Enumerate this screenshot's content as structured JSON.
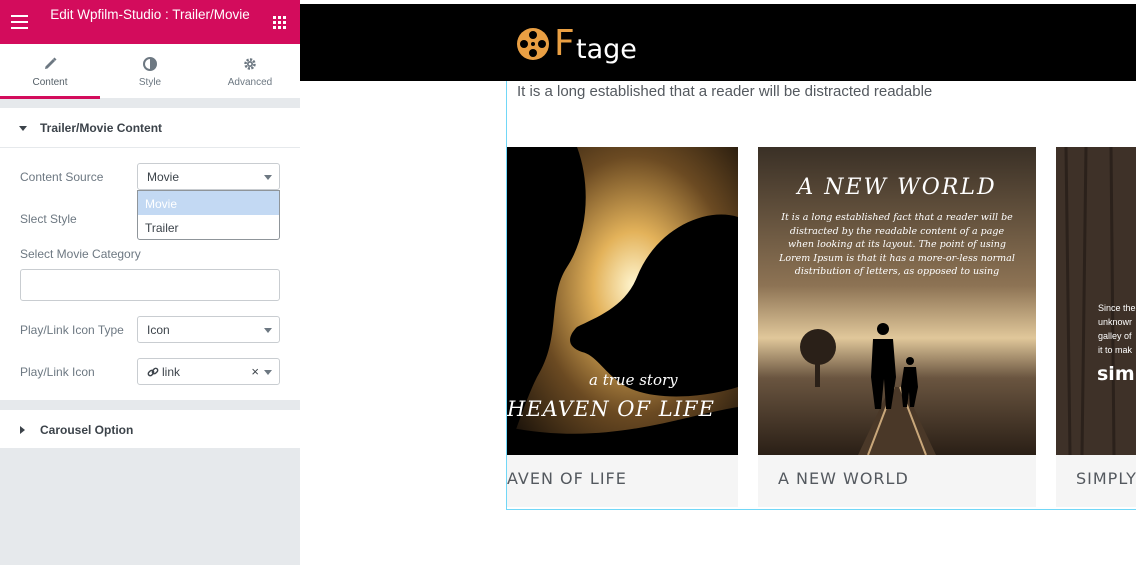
{
  "panel": {
    "header_title": "Edit Wpfilm-Studio : Trailer/Movie",
    "tabs": [
      {
        "label": "Content",
        "icon": "pencil-icon"
      },
      {
        "label": "Style",
        "icon": "contrast-icon"
      },
      {
        "label": "Advanced",
        "icon": "gear-icon"
      }
    ],
    "accent_color": "#d30c5c",
    "section1": {
      "title": "Trailer/Movie Content",
      "content_source_label": "Content Source",
      "content_source_value": "Movie",
      "dropdown_options": [
        "Movie",
        "Trailer"
      ],
      "slect_style_label": "Slect Style",
      "movie_category_label": "Select Movie Category",
      "icon_type_label": "Play/Link Icon Type",
      "icon_type_value": "Icon",
      "icon_label": "Play/Link Icon",
      "icon_value": "link",
      "clear_symbol": "×"
    },
    "section2": {
      "title": "Carousel Option"
    }
  },
  "preview": {
    "logo_text": "tage",
    "logo_f": "F",
    "intro_text": "It is a long established that a reader will be distracted readable",
    "cards": [
      {
        "title": "AVEN OF LIFE",
        "poster_tagline": "a true story",
        "poster_title": "HEAVEN OF LIFE"
      },
      {
        "title": "A NEW WORLD",
        "poster_title": "A NEW WORLD",
        "poster_body": "It is a long established fact that a reader will be distracted by the readable content of a page when looking at its layout. The point of using Lorem Ipsum is that it has a more-or-less normal distribution of letters, as opposed to using"
      },
      {
        "title": "SIMPLY",
        "poster_lines": [
          "Since the",
          "unknowr",
          "galley of",
          "it to mak"
        ],
        "poster_word": "simp"
      }
    ]
  }
}
